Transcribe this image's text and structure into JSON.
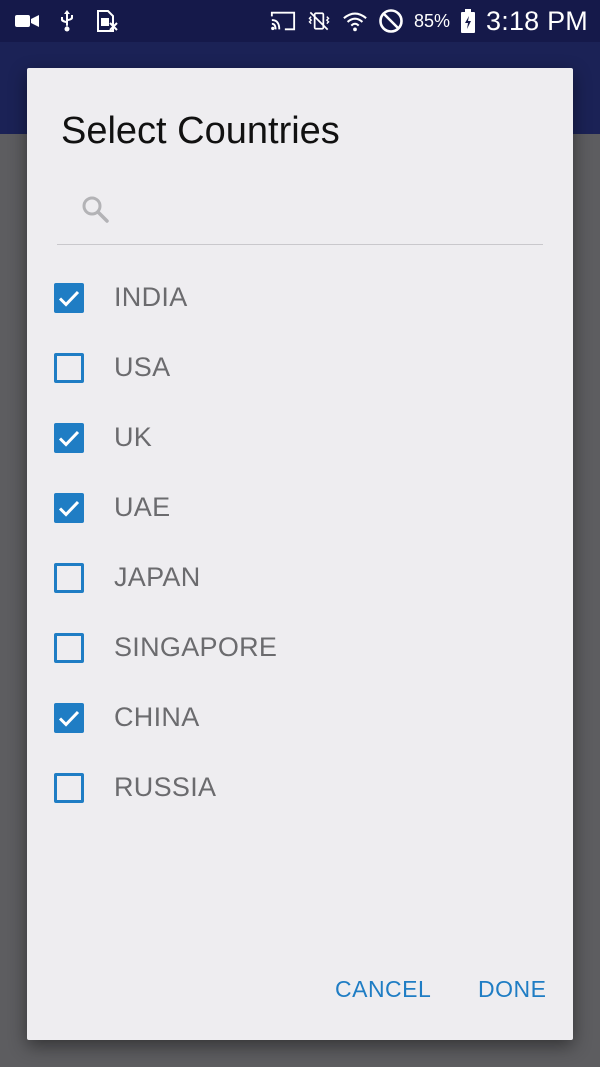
{
  "status_bar": {
    "icons_left": [
      "video-camera-icon",
      "usb-icon",
      "sim-card-icon"
    ],
    "icons_right": [
      "cast-icon",
      "vibrate-mute-icon",
      "wifi-icon",
      "do-not-disturb-icon",
      "battery-icon"
    ],
    "battery": "85%",
    "time": "3:18 PM"
  },
  "dialog": {
    "title": "Select Countries",
    "search": {
      "value": "",
      "icon": "search-icon"
    },
    "items": [
      {
        "label": "INDIA",
        "checked": true
      },
      {
        "label": "USA",
        "checked": false
      },
      {
        "label": "UK",
        "checked": true
      },
      {
        "label": "UAE",
        "checked": true
      },
      {
        "label": "JAPAN",
        "checked": false
      },
      {
        "label": "SINGAPORE",
        "checked": false
      },
      {
        "label": "CHINA",
        "checked": true
      },
      {
        "label": "RUSSIA",
        "checked": false
      }
    ],
    "cancel_label": "CANCEL",
    "done_label": "DONE"
  },
  "colors": {
    "accent": "#1f7dc4",
    "status_bar": "#15194a",
    "app_bar": "#1b2256",
    "dialog_bg": "#eeedf0",
    "scrim": "#5d5d60"
  }
}
